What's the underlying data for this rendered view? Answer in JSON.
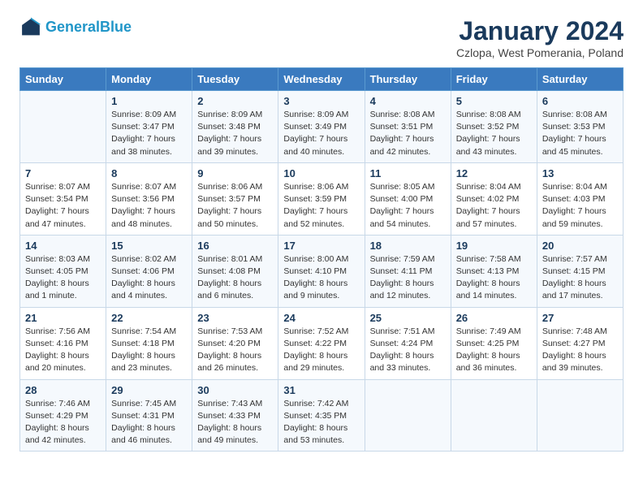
{
  "header": {
    "logo_line1": "General",
    "logo_line2": "Blue",
    "month": "January 2024",
    "location": "Czlopa, West Pomerania, Poland"
  },
  "days_of_week": [
    "Sunday",
    "Monday",
    "Tuesday",
    "Wednesday",
    "Thursday",
    "Friday",
    "Saturday"
  ],
  "weeks": [
    [
      {
        "day": "",
        "sunrise": "",
        "sunset": "",
        "daylight": ""
      },
      {
        "day": "1",
        "sunrise": "Sunrise: 8:09 AM",
        "sunset": "Sunset: 3:47 PM",
        "daylight": "Daylight: 7 hours and 38 minutes."
      },
      {
        "day": "2",
        "sunrise": "Sunrise: 8:09 AM",
        "sunset": "Sunset: 3:48 PM",
        "daylight": "Daylight: 7 hours and 39 minutes."
      },
      {
        "day": "3",
        "sunrise": "Sunrise: 8:09 AM",
        "sunset": "Sunset: 3:49 PM",
        "daylight": "Daylight: 7 hours and 40 minutes."
      },
      {
        "day": "4",
        "sunrise": "Sunrise: 8:08 AM",
        "sunset": "Sunset: 3:51 PM",
        "daylight": "Daylight: 7 hours and 42 minutes."
      },
      {
        "day": "5",
        "sunrise": "Sunrise: 8:08 AM",
        "sunset": "Sunset: 3:52 PM",
        "daylight": "Daylight: 7 hours and 43 minutes."
      },
      {
        "day": "6",
        "sunrise": "Sunrise: 8:08 AM",
        "sunset": "Sunset: 3:53 PM",
        "daylight": "Daylight: 7 hours and 45 minutes."
      }
    ],
    [
      {
        "day": "7",
        "sunrise": "Sunrise: 8:07 AM",
        "sunset": "Sunset: 3:54 PM",
        "daylight": "Daylight: 7 hours and 47 minutes."
      },
      {
        "day": "8",
        "sunrise": "Sunrise: 8:07 AM",
        "sunset": "Sunset: 3:56 PM",
        "daylight": "Daylight: 7 hours and 48 minutes."
      },
      {
        "day": "9",
        "sunrise": "Sunrise: 8:06 AM",
        "sunset": "Sunset: 3:57 PM",
        "daylight": "Daylight: 7 hours and 50 minutes."
      },
      {
        "day": "10",
        "sunrise": "Sunrise: 8:06 AM",
        "sunset": "Sunset: 3:59 PM",
        "daylight": "Daylight: 7 hours and 52 minutes."
      },
      {
        "day": "11",
        "sunrise": "Sunrise: 8:05 AM",
        "sunset": "Sunset: 4:00 PM",
        "daylight": "Daylight: 7 hours and 54 minutes."
      },
      {
        "day": "12",
        "sunrise": "Sunrise: 8:04 AM",
        "sunset": "Sunset: 4:02 PM",
        "daylight": "Daylight: 7 hours and 57 minutes."
      },
      {
        "day": "13",
        "sunrise": "Sunrise: 8:04 AM",
        "sunset": "Sunset: 4:03 PM",
        "daylight": "Daylight: 7 hours and 59 minutes."
      }
    ],
    [
      {
        "day": "14",
        "sunrise": "Sunrise: 8:03 AM",
        "sunset": "Sunset: 4:05 PM",
        "daylight": "Daylight: 8 hours and 1 minute."
      },
      {
        "day": "15",
        "sunrise": "Sunrise: 8:02 AM",
        "sunset": "Sunset: 4:06 PM",
        "daylight": "Daylight: 8 hours and 4 minutes."
      },
      {
        "day": "16",
        "sunrise": "Sunrise: 8:01 AM",
        "sunset": "Sunset: 4:08 PM",
        "daylight": "Daylight: 8 hours and 6 minutes."
      },
      {
        "day": "17",
        "sunrise": "Sunrise: 8:00 AM",
        "sunset": "Sunset: 4:10 PM",
        "daylight": "Daylight: 8 hours and 9 minutes."
      },
      {
        "day": "18",
        "sunrise": "Sunrise: 7:59 AM",
        "sunset": "Sunset: 4:11 PM",
        "daylight": "Daylight: 8 hours and 12 minutes."
      },
      {
        "day": "19",
        "sunrise": "Sunrise: 7:58 AM",
        "sunset": "Sunset: 4:13 PM",
        "daylight": "Daylight: 8 hours and 14 minutes."
      },
      {
        "day": "20",
        "sunrise": "Sunrise: 7:57 AM",
        "sunset": "Sunset: 4:15 PM",
        "daylight": "Daylight: 8 hours and 17 minutes."
      }
    ],
    [
      {
        "day": "21",
        "sunrise": "Sunrise: 7:56 AM",
        "sunset": "Sunset: 4:16 PM",
        "daylight": "Daylight: 8 hours and 20 minutes."
      },
      {
        "day": "22",
        "sunrise": "Sunrise: 7:54 AM",
        "sunset": "Sunset: 4:18 PM",
        "daylight": "Daylight: 8 hours and 23 minutes."
      },
      {
        "day": "23",
        "sunrise": "Sunrise: 7:53 AM",
        "sunset": "Sunset: 4:20 PM",
        "daylight": "Daylight: 8 hours and 26 minutes."
      },
      {
        "day": "24",
        "sunrise": "Sunrise: 7:52 AM",
        "sunset": "Sunset: 4:22 PM",
        "daylight": "Daylight: 8 hours and 29 minutes."
      },
      {
        "day": "25",
        "sunrise": "Sunrise: 7:51 AM",
        "sunset": "Sunset: 4:24 PM",
        "daylight": "Daylight: 8 hours and 33 minutes."
      },
      {
        "day": "26",
        "sunrise": "Sunrise: 7:49 AM",
        "sunset": "Sunset: 4:25 PM",
        "daylight": "Daylight: 8 hours and 36 minutes."
      },
      {
        "day": "27",
        "sunrise": "Sunrise: 7:48 AM",
        "sunset": "Sunset: 4:27 PM",
        "daylight": "Daylight: 8 hours and 39 minutes."
      }
    ],
    [
      {
        "day": "28",
        "sunrise": "Sunrise: 7:46 AM",
        "sunset": "Sunset: 4:29 PM",
        "daylight": "Daylight: 8 hours and 42 minutes."
      },
      {
        "day": "29",
        "sunrise": "Sunrise: 7:45 AM",
        "sunset": "Sunset: 4:31 PM",
        "daylight": "Daylight: 8 hours and 46 minutes."
      },
      {
        "day": "30",
        "sunrise": "Sunrise: 7:43 AM",
        "sunset": "Sunset: 4:33 PM",
        "daylight": "Daylight: 8 hours and 49 minutes."
      },
      {
        "day": "31",
        "sunrise": "Sunrise: 7:42 AM",
        "sunset": "Sunset: 4:35 PM",
        "daylight": "Daylight: 8 hours and 53 minutes."
      },
      {
        "day": "",
        "sunrise": "",
        "sunset": "",
        "daylight": ""
      },
      {
        "day": "",
        "sunrise": "",
        "sunset": "",
        "daylight": ""
      },
      {
        "day": "",
        "sunrise": "",
        "sunset": "",
        "daylight": ""
      }
    ]
  ]
}
